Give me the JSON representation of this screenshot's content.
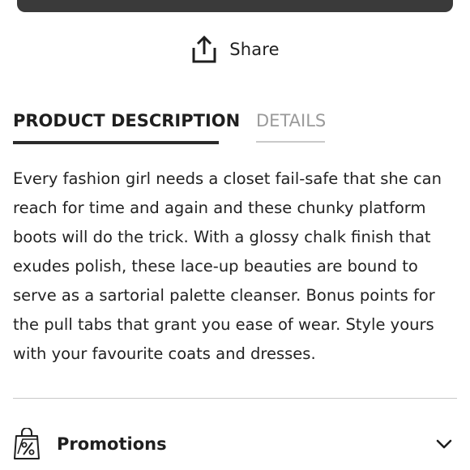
{
  "share": {
    "label": "Share",
    "icon": "share-upload-icon"
  },
  "tabs": [
    {
      "label": "PRODUCT DESCRIPTION",
      "active": true
    },
    {
      "label": "DETAILS",
      "active": false
    }
  ],
  "description": {
    "text": "Every fashion girl needs a closet fail-safe that she can reach for time and again and these chunky platform boots will do the trick. With a glossy chalk finish that exudes polish, these lace-up beauties are bound to serve as a sartorial palette cleanser. Bonus points for the pull tabs that grant you ease of wear. Style yours with your favourite coats and dresses."
  },
  "promotions": {
    "title": "Promotions",
    "icon": "percent-bag-icon",
    "toggle_icon": "chevron-down-icon"
  },
  "colors": {
    "text": "#1f1f1f",
    "inactive_tab": "#9a9a9a",
    "top_button": "#3a3a3a",
    "divider": "#c8c8c8"
  }
}
